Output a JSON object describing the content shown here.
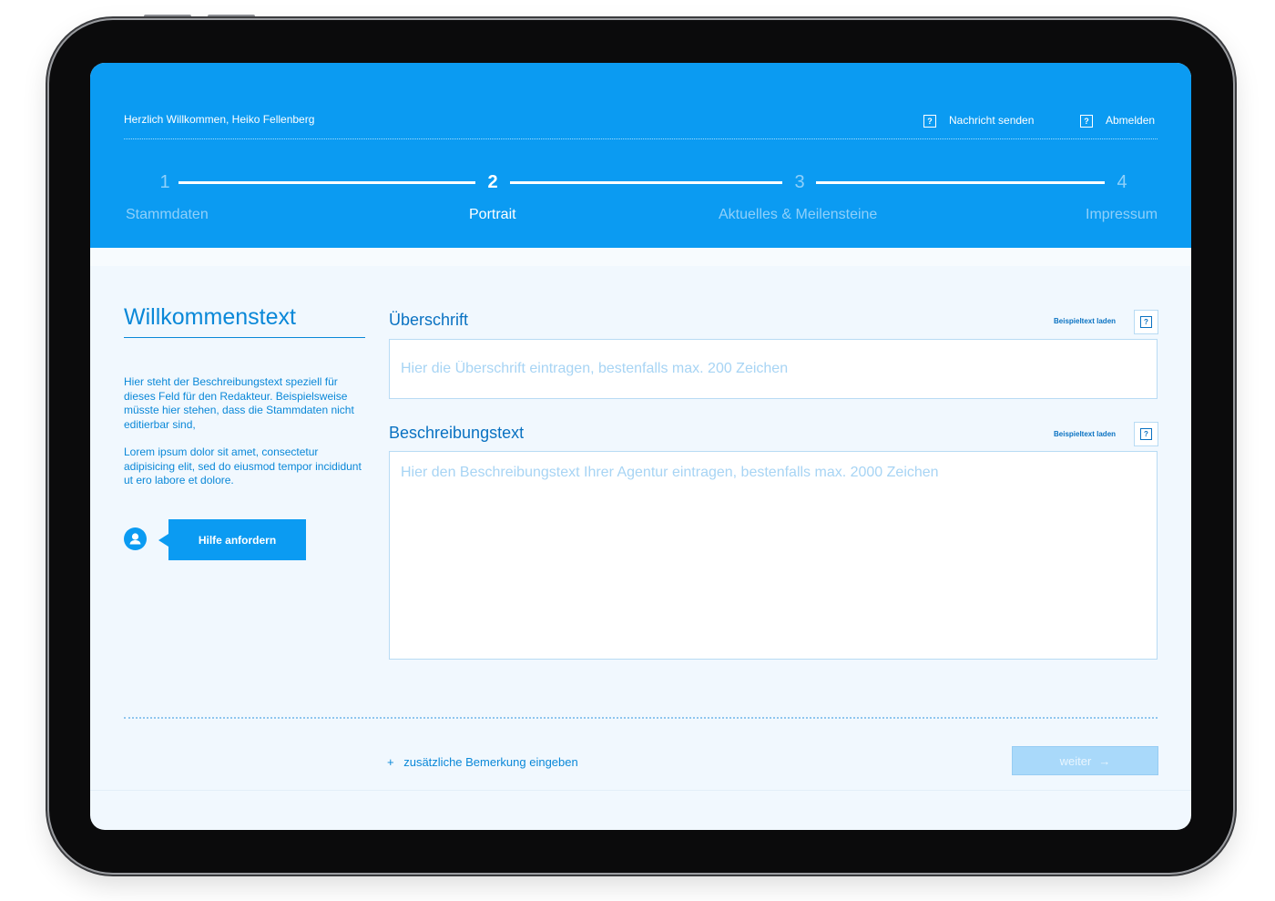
{
  "header": {
    "welcome": "Herzlich Willkommen, Heiko Fellenberg",
    "message_link": "Nachricht senden",
    "logout_link": "Abmelden",
    "link_icon": "?"
  },
  "steps": [
    {
      "number": "1",
      "label": "Stammdaten",
      "active": false
    },
    {
      "number": "2",
      "label": "Portrait",
      "active": true
    },
    {
      "number": "3",
      "label": "Aktuelles & Meilensteine",
      "active": false
    },
    {
      "number": "4",
      "label": "Impressum",
      "active": false
    }
  ],
  "sidebar": {
    "title": "Willkommenstext",
    "description": "Hier steht der Beschreibungstext speziell für dieses Feld für den Redakteur. Beispielsweise müsste hier stehen, dass die Stammdaten nicht editierbar sind,",
    "lorem": "Lorem ipsum dolor sit amet, consectetur adipisicing elit, sed do eiusmod tempor incididunt ut ero labore et dolore.",
    "help_button": "Hilfe anfordern"
  },
  "form": {
    "headline": {
      "label": "Überschrift",
      "sample_link": "Beispieltext laden",
      "help_icon": "?",
      "placeholder": "Hier die Überschrift eintragen, bestenfalls max. 200 Zeichen"
    },
    "description": {
      "label": "Beschreibungstext",
      "sample_link": "Beispieltext laden",
      "help_icon": "?",
      "placeholder": "Hier den Beschreibungstext Ihrer Agentur eintragen, bestenfalls max. 2000 Zeichen"
    }
  },
  "footer": {
    "add_remark_plus": "+",
    "add_remark": "zusätzliche Bemerkung eingeben",
    "next_button": "weiter",
    "next_arrow": "→"
  },
  "colors": {
    "primary": "#0b9bf2",
    "text_blue": "#0a88d8",
    "background": "#f1f8fe",
    "disabled_button": "#a9d9fa"
  }
}
